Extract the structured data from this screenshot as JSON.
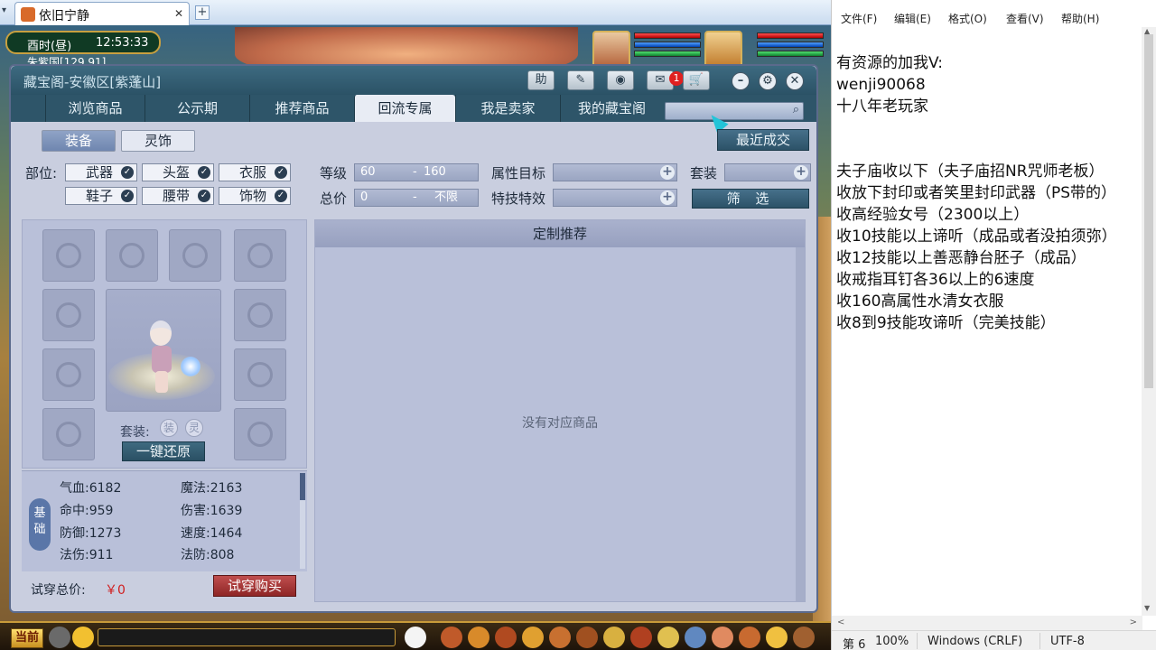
{
  "browser": {
    "tab_title": "依旧宁静",
    "close_glyph": "✕",
    "new_tab_glyph": "+"
  },
  "game": {
    "time_of_day": "酉时(昼)",
    "clock": "12:53:33",
    "location": "朱紫国[129,91]",
    "hud_channel": "当前"
  },
  "dialog": {
    "title": "藏宝阁-安徽区[紫蓬山]",
    "header_buttons": {
      "help": "助"
    },
    "message_badge": "1",
    "nav_tabs": [
      "浏览商品",
      "公示期",
      "推荐商品",
      "回流专属",
      "我是卖家",
      "我的藏宝阁"
    ],
    "active_tab_index": 3,
    "subtabs": [
      "装备",
      "灵饰"
    ],
    "recent_deals": "最近成交",
    "filters": {
      "slot_label": "部位:",
      "slots": [
        "武器",
        "头盔",
        "衣服",
        "鞋子",
        "腰带",
        "饰物"
      ],
      "level_label": "等级",
      "level_min": "60",
      "level_max": "160",
      "price_label": "总价",
      "price_min": "0",
      "price_max": "不限",
      "range_sep": "-",
      "attr_target_label": "属性目标",
      "skill_label": "特技特效",
      "set_label": "套装",
      "filter_button": "筛 选"
    },
    "equip": {
      "set_label": "套装:",
      "set_chips": [
        "装",
        "灵"
      ],
      "reset_button": "一键还原"
    },
    "stats": {
      "tag": "基础",
      "items": [
        {
          "label": "气血",
          "value": "6182"
        },
        {
          "label": "魔法",
          "value": "2163"
        },
        {
          "label": "命中",
          "value": "959"
        },
        {
          "label": "伤害",
          "value": "1639"
        },
        {
          "label": "防御",
          "value": "1273"
        },
        {
          "label": "速度",
          "value": "1464"
        },
        {
          "label": "法伤",
          "value": "911"
        },
        {
          "label": "法防",
          "value": "808"
        }
      ]
    },
    "try_total_label": "试穿总价:",
    "try_total_value": "￥0",
    "try_buy_button": "试穿购买",
    "results": {
      "header": "定制推荐",
      "empty": "没有对应商品"
    }
  },
  "notepad": {
    "menus": [
      "文件(F)",
      "编辑(E)",
      "格式(O)",
      "查看(V)",
      "帮助(H)"
    ],
    "lines": [
      "有资源的加我V:",
      "wenji90068",
      "十八年老玩家",
      "",
      "",
      "夫子庙收以下（夫子庙招NR咒师老板）",
      "收放下封印或者笑里封印武器（PS带的）",
      "收高经验女号（2300以上）",
      "收10技能以上谛听（成品或者没拍须弥）",
      "收12技能以上善恶静台胚子（成品）",
      "收戒指耳钉各36以上的6速度",
      "收160高属性水清女衣服",
      "收8到9技能攻谛听（完美技能）"
    ],
    "status": {
      "position": "第 6",
      "zoom": "100%",
      "line_ending": "Windows (CRLF)",
      "encoding": "UTF-8"
    }
  }
}
